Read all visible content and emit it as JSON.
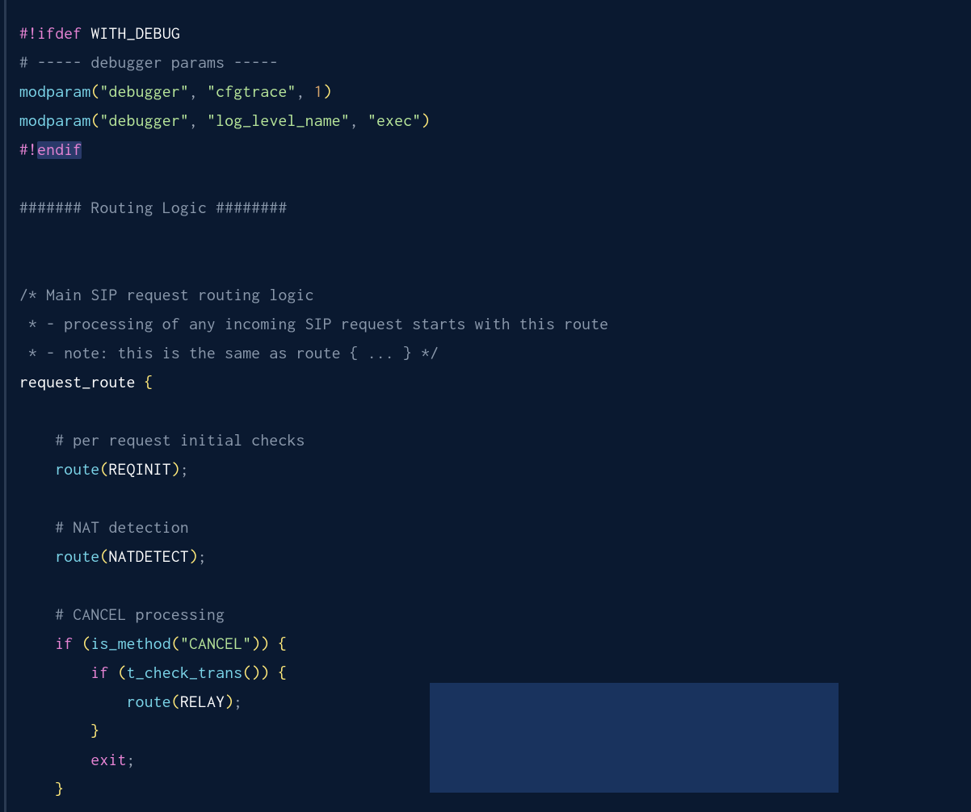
{
  "code": {
    "l1": {
      "hash": "#!",
      "kw": "ifdef",
      "sym": " WITH_DEBUG"
    },
    "l2": "# ----- debugger params -----",
    "l3": {
      "fn": "modparam",
      "p1": "(",
      "s1": "\"debugger\"",
      "c1": ",",
      "sp1": " ",
      "s2": "\"cfgtrace\"",
      "c2": ",",
      "sp2": " ",
      "n": "1",
      "p2": ")"
    },
    "l4": {
      "fn": "modparam",
      "p1": "(",
      "s1": "\"debugger\"",
      "c1": ",",
      "sp1": " ",
      "s2": "\"log_level_name\"",
      "c2": ",",
      "sp2": " ",
      "s3": "\"exec\"",
      "p2": ")"
    },
    "l5": {
      "hash": "#!",
      "kw": "endif"
    },
    "l7": "####### Routing Logic ########",
    "l10": "/* Main SIP request routing logic",
    "l11": " * - processing of any incoming SIP request starts with this route",
    "l12": " * - note: this is the same as route { ... } */",
    "l13": {
      "id": "request_route ",
      "b": "{"
    },
    "l15": "    # per request initial checks",
    "l16": {
      "pad": "    ",
      "fn": "route",
      "p1": "(",
      "id": "REQINIT",
      "p2": ")",
      "s": ";"
    },
    "l18": "    # NAT detection",
    "l19": {
      "pad": "    ",
      "fn": "route",
      "p1": "(",
      "id": "NATDETECT",
      "p2": ")",
      "s": ";"
    },
    "l21": "    # CANCEL processing",
    "l22": {
      "pad": "    ",
      "kw": "if",
      "sp": " ",
      "p1": "(",
      "fn": "is_method",
      "p2": "(",
      "str": "\"CANCEL\"",
      "p3": ")",
      "p4": ")",
      "sp2": " ",
      "b": "{"
    },
    "l23": {
      "pad": "        ",
      "kw": "if",
      "sp": " ",
      "p1": "(",
      "fn": "t_check_trans",
      "p2": "(",
      "p3": ")",
      "p4": ")",
      "sp2": " ",
      "b": "{"
    },
    "l24": {
      "pad": "            ",
      "fn": "route",
      "p1": "(",
      "id": "RELAY",
      "p2": ")",
      "s": ";"
    },
    "l25": {
      "pad": "        ",
      "b": "}"
    },
    "l26": {
      "pad": "        ",
      "kw": "exit",
      "s": ";"
    },
    "l27": {
      "pad": "    ",
      "b": "}"
    }
  }
}
